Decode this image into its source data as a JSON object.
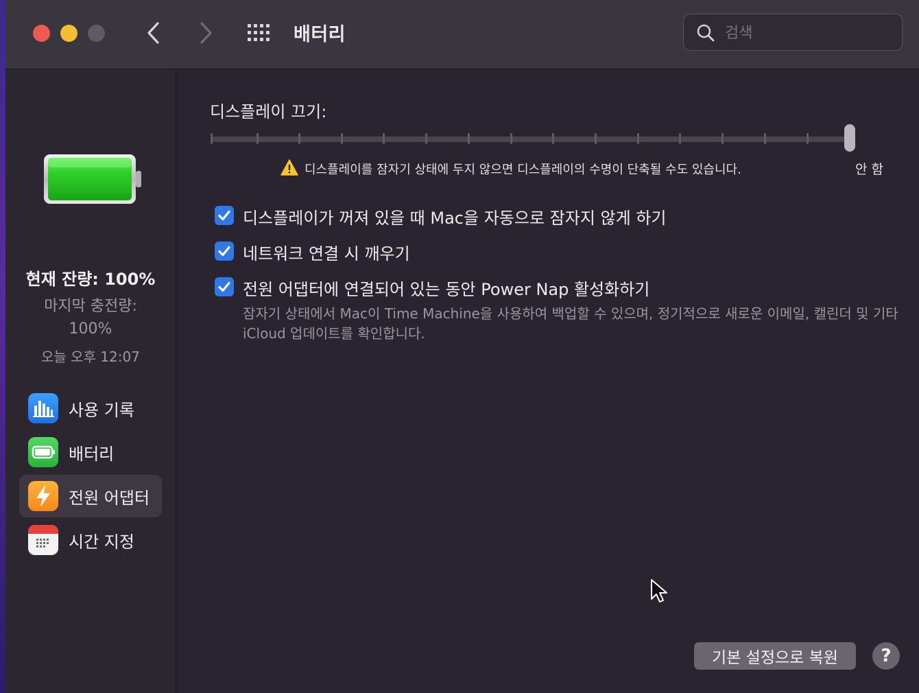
{
  "window": {
    "title": "배터리"
  },
  "search": {
    "placeholder": "검색"
  },
  "sidebar": {
    "battery_status": {
      "level_text": "현재 잔량: 100%",
      "last_charged_label": "마지막 충전량:",
      "last_charged_value": "100%",
      "timestamp": "오늘 오후 12:07"
    },
    "items": [
      {
        "label": "사용 기록",
        "icon": "usage-history-icon",
        "selected": false
      },
      {
        "label": "배터리",
        "icon": "battery-icon",
        "selected": false
      },
      {
        "label": "전원 어댑터",
        "icon": "power-adapter-icon",
        "selected": true
      },
      {
        "label": "시간 지정",
        "icon": "schedule-icon",
        "selected": false
      }
    ]
  },
  "main": {
    "display_off_label": "디스플레이 끄기:",
    "slider": {
      "position": "안 함",
      "end_label": "안 함"
    },
    "warning": "디스플레이를 잠자기 상태에 두지 않으면 디스플레이의 수명이 단축될 수도 있습니다.",
    "options": [
      {
        "label": "디스플레이가 꺼져 있을 때 Mac을 자동으로 잠자지 않게 하기",
        "checked": true
      },
      {
        "label": "네트워크 연결 시 깨우기",
        "checked": true
      },
      {
        "label": "전원 어댑터에 연결되어 있는 동안 Power Nap 활성화하기",
        "checked": true
      }
    ],
    "power_nap_description": "잠자기 상태에서 Mac이 Time Machine을 사용하여 백업할 수 있으며, 정기적으로 새로운 이메일, 캘린더 및 기타 iCloud 업데이트를 확인합니다.",
    "restore_button": "기본 설정으로 복원",
    "help_button": "?"
  },
  "colors": {
    "accent": "#2f78e6",
    "battery_green": "#2fd02a",
    "selected_item_bg": "#3d3842"
  }
}
